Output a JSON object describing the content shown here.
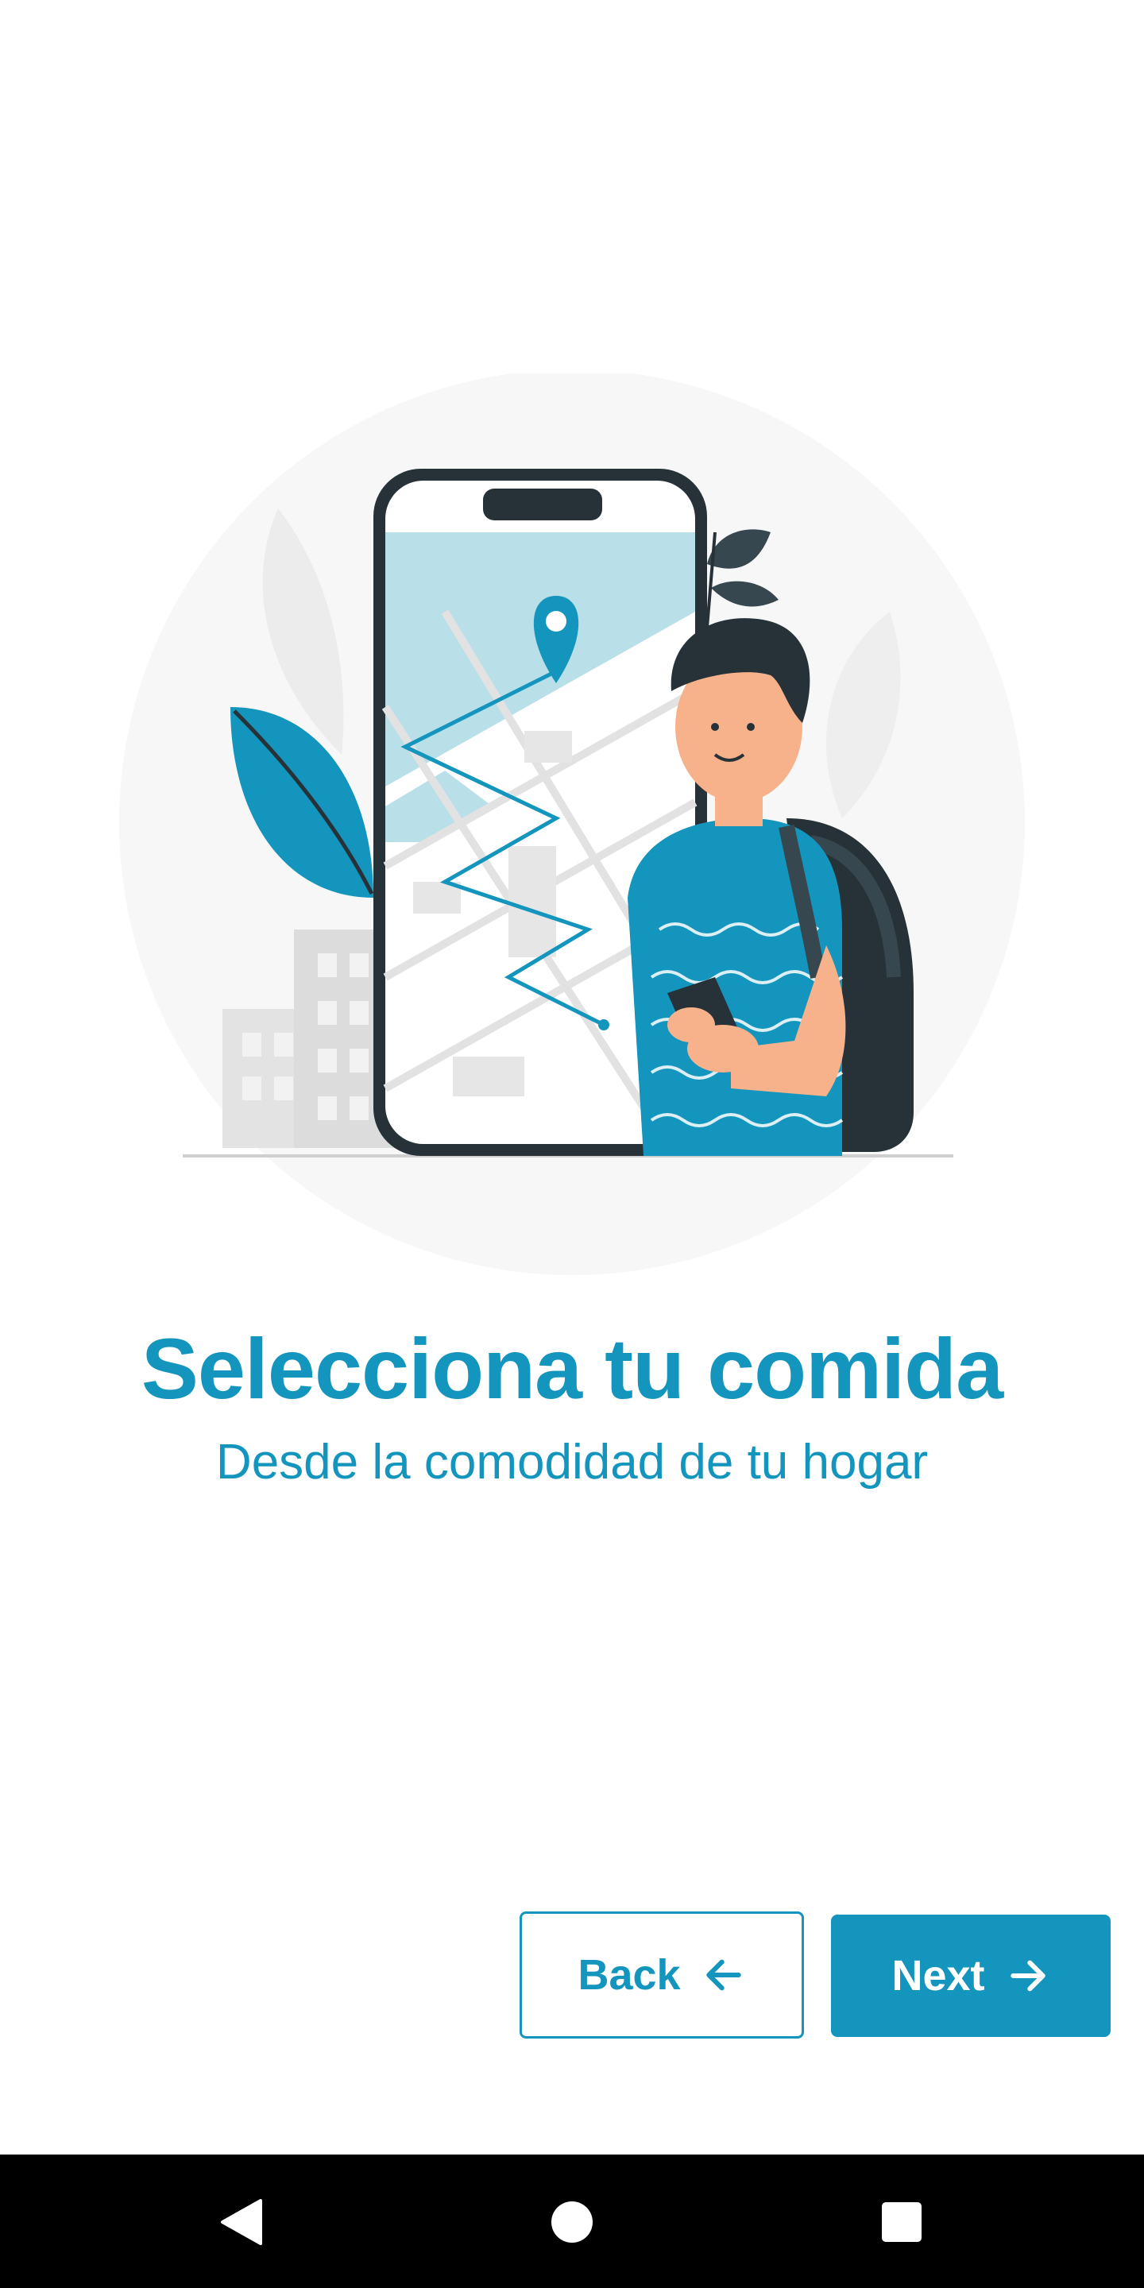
{
  "onboarding": {
    "title": "Selecciona tu comida",
    "subtitle": "Desde la comodidad de tu hogar",
    "illustration_icon": "person-with-phone-map-illustration"
  },
  "actions": {
    "back_label": "Back",
    "back_icon": "arrow-left-icon",
    "next_label": "Next",
    "next_icon": "arrow-right-icon"
  },
  "system_nav": {
    "back_icon": "nav-back-triangle-icon",
    "home_icon": "nav-home-circle-icon",
    "recents_icon": "nav-recents-square-icon"
  },
  "colors": {
    "accent": "#1495bd",
    "background": "#ffffff",
    "nav_bar": "#000000"
  }
}
